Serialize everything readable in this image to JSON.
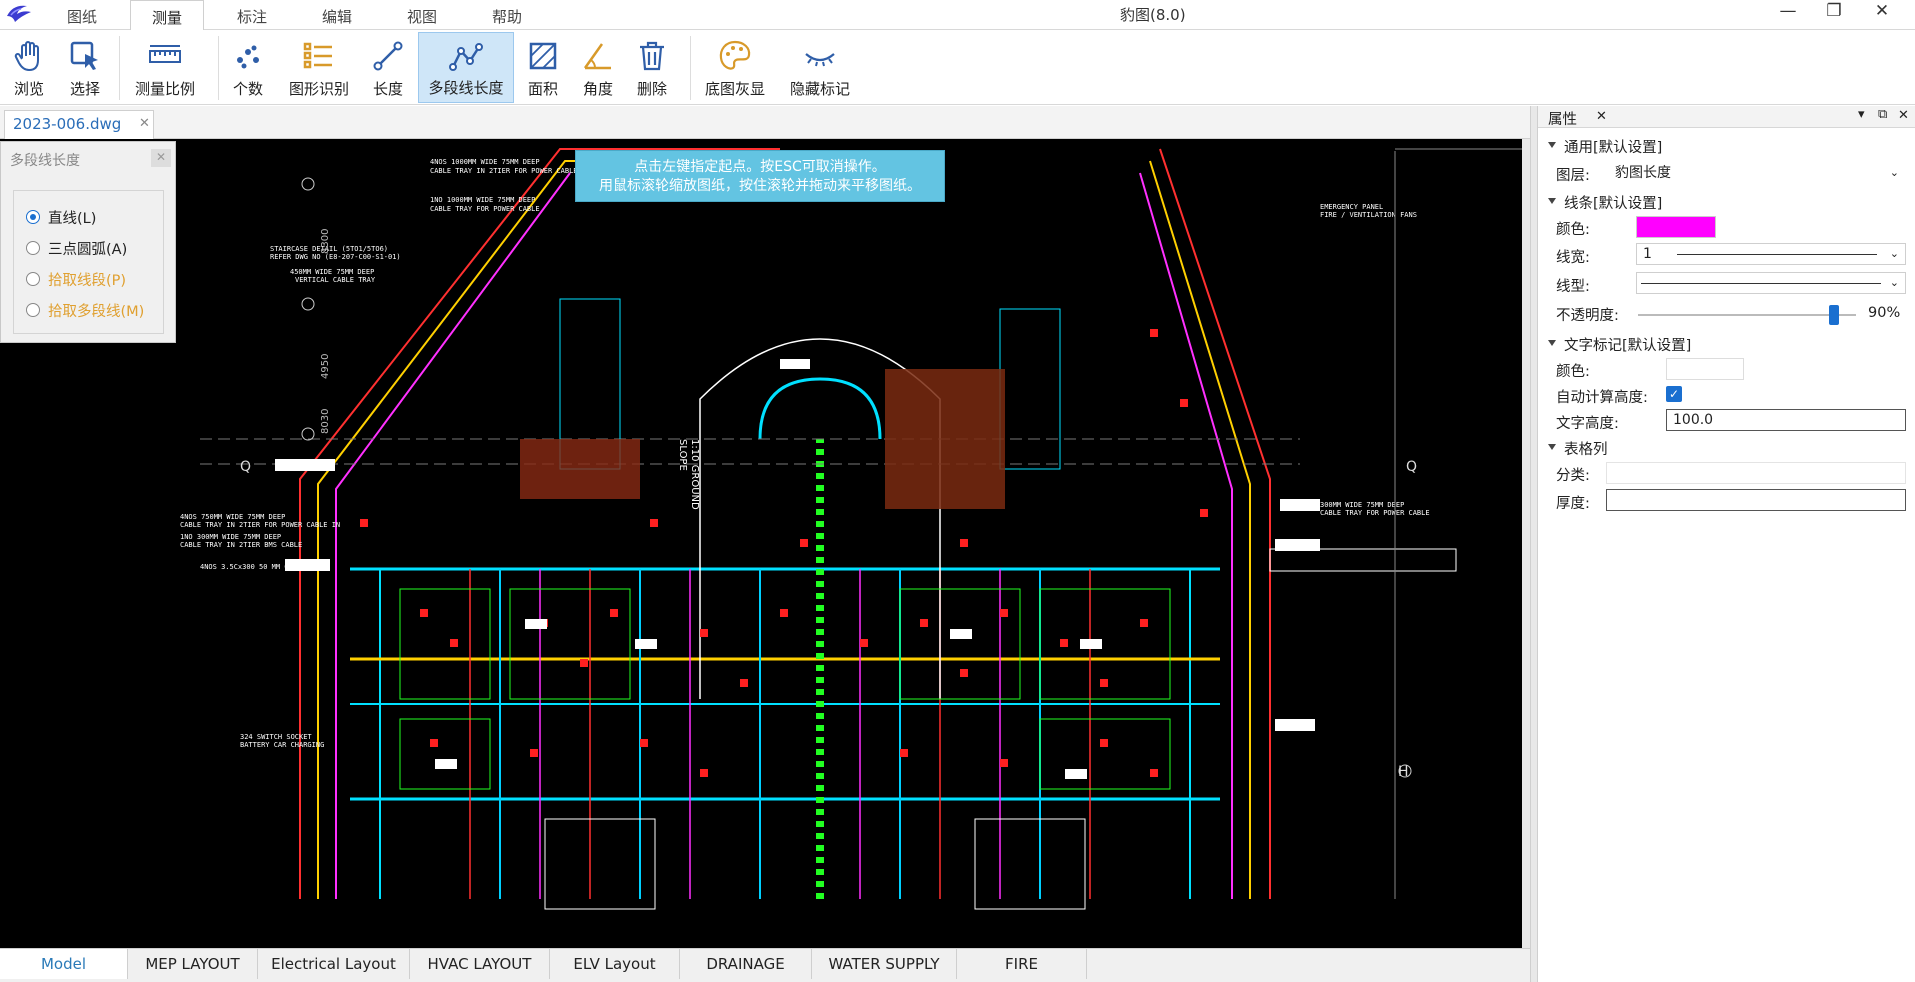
{
  "app": {
    "title": "豹图(8.0)"
  },
  "menu": {
    "tabs": [
      "图纸",
      "测量",
      "标注",
      "编辑",
      "视图",
      "帮助"
    ],
    "active": "测量"
  },
  "window_controls": {
    "minimize": "—",
    "maximize": "❐",
    "close": "✕"
  },
  "ribbon": {
    "buttons": [
      "浏览",
      "选择",
      "测量比例",
      "个数",
      "图形识别",
      "长度",
      "多段线长度",
      "面积",
      "角度",
      "删除",
      "底图灰显",
      "隐藏标记"
    ],
    "active": "多段线长度"
  },
  "document": {
    "tab": "2023-006.dwg",
    "close": "✕"
  },
  "hint": {
    "line1": "点击左键指定起点。按ESC可取消操作。",
    "line2": "用鼠标滚轮缩放图纸，按住滚轮并拖动来平移图纸。"
  },
  "poly_panel": {
    "title": "多段线长度",
    "close": "✕",
    "options": [
      {
        "label": "直线(L)",
        "selected": true,
        "enabled": true
      },
      {
        "label": "三点圆弧(A)",
        "selected": false,
        "enabled": true
      },
      {
        "label": "拾取线段(P)",
        "selected": false,
        "enabled": false
      },
      {
        "label": "拾取多段线(M)",
        "selected": false,
        "enabled": false
      }
    ]
  },
  "layout_tabs": [
    "Model",
    "MEP LAYOUT",
    "Electrical Layout",
    "HVAC LAYOUT",
    "ELV Layout",
    "DRAINAGE",
    "WATER SUPPLY",
    "FIRE"
  ],
  "properties": {
    "title": "属性",
    "close": "✕",
    "header_icons": [
      "▾",
      "⧉",
      "✕"
    ],
    "general": {
      "section": "通用[默认设置]",
      "layer_label": "图层:",
      "layer_value": "豹图长度"
    },
    "line": {
      "section": "线条[默认设置]",
      "color_label": "颜色:",
      "color": "#ff00ff",
      "width_label": "线宽:",
      "width_value": "1",
      "type_label": "线型:",
      "opacity_label": "不透明度:",
      "opacity": "90%",
      "opacity_level": 0.9
    },
    "text": {
      "section": "文字标记[默认设置]",
      "color_label": "颜色:",
      "color": "#ffffff",
      "auto_label": "自动计算高度:",
      "auto": true,
      "height_label": "文字高度:",
      "height_value": "100.0"
    },
    "table": {
      "section": "表格列",
      "category_label": "分类:",
      "thickness_label": "厚度:"
    }
  },
  "drawing_text": {
    "markers": [
      "Q",
      "Q",
      "H"
    ],
    "dims": [
      "8300",
      "4950",
      "8030"
    ],
    "notes": [
      "4NOS 1000MM WIDE 75MM DEEP",
      "CABLE TRAY IN 2TIER FOR POWER CABLE",
      "1NO 1000MM WIDE 75MM DEEP",
      "CABLE TRAY FOR POWER CABLE",
      "STAIRCASE DETAIL (5TO1/5TO6)",
      "REFER DWG NO (E8-207-C00-S1-01)",
      "450MM WIDE 75MM DEEP",
      "VERTICAL CABLE TRAY",
      "4NOS 750MM WIDE 75MM DEEP",
      "CABLE TRAY IN 2TIER FOR POWER CABLE IN",
      "1NO 300MM WIDE 75MM DEEP",
      "CABLE TRAY IN 2TIER BMS CABLE",
      "4NOS 3.5Cx300 50 MM CABLES",
      "324 SWITCH SOCKET",
      "BATTERY CAR CHARGING",
      "EMERGENCY PANEL",
      "FIRE / VENTILATION FANS",
      "300MM WIDE 75MM DEEP",
      "CABLE TRAY FOR POWER CABLE",
      "1:10 GROUND",
      "SLOPE"
    ]
  }
}
